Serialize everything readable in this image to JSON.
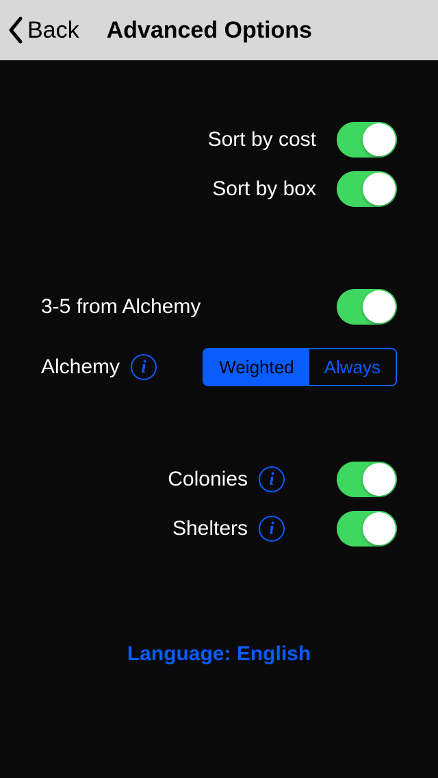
{
  "header": {
    "back_label": "Back",
    "title": "Advanced Options"
  },
  "options": {
    "sort_by_cost_label": "Sort by cost",
    "sort_by_cost_on": true,
    "sort_by_box_label": "Sort by box",
    "sort_by_box_on": true,
    "alchemy_range_label": "3-5 from Alchemy",
    "alchemy_range_on": true,
    "alchemy_label": "Alchemy",
    "alchemy_seg_weighted": "Weighted",
    "alchemy_seg_always": "Always",
    "alchemy_seg_selected": "Weighted",
    "colonies_label": "Colonies",
    "colonies_on": true,
    "shelters_label": "Shelters",
    "shelters_on": true
  },
  "language_label": "Language: English"
}
